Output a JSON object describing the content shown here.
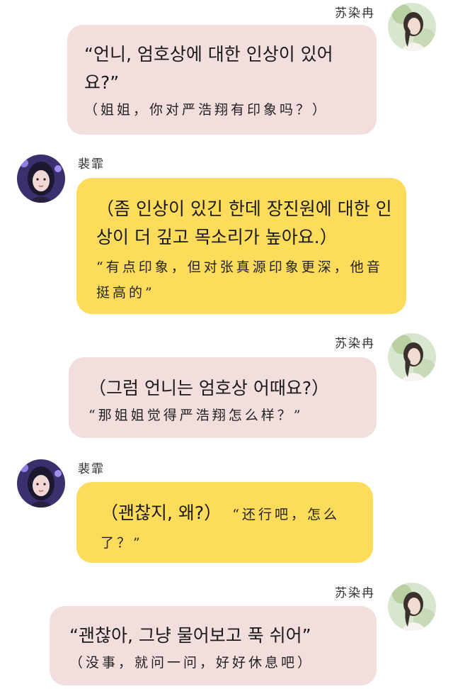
{
  "sender_right": "苏染冉",
  "sender_left": "裴霏",
  "messages": [
    {
      "side": "right",
      "name": "苏染冉",
      "korean": "“언니, 엄호상에 대한 인상이 있어요?”",
      "chinese": "（姐姐，你对严浩翔有印象吗？）"
    },
    {
      "side": "left",
      "name": "裴霏",
      "korean": "（좀 인상이 있긴 한데 장진원에 대한 인상이 더 깊고 목소리가 높아요.）",
      "chinese": "“有点印象，但对张真源印象更深，他音挺高的”"
    },
    {
      "side": "right",
      "name": "苏染冉",
      "korean": "（그럼 언니는 엄호상 어때요?）",
      "chinese": "“那姐姐觉得严浩翔怎么样？”"
    },
    {
      "side": "left",
      "name": "裴霏",
      "korean": "（괜찮지, 왜?）",
      "chinese": "“还行吧，怎么了？”"
    },
    {
      "side": "right",
      "name": "苏染冉",
      "korean": "“괜찮아, 그냥 물어보고 푹 쉬어”",
      "chinese": "（没事，就问一问，好好休息吧）"
    }
  ],
  "colors": {
    "pink_bubble": "#f3dede",
    "yellow_bubble": "#fddc5c"
  },
  "icons": {
    "right_avatar": "avatar-suranran-icon",
    "left_avatar": "avatar-peifei-icon"
  }
}
